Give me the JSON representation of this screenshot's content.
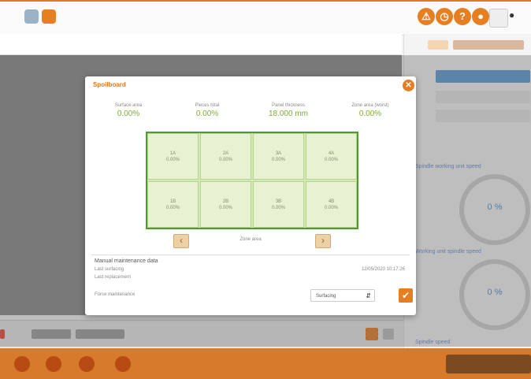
{
  "modal": {
    "title": "Spoilboard",
    "stats": [
      {
        "label": "Surface area",
        "value": "0.00%"
      },
      {
        "label": "Pieces total",
        "value": "0.00%"
      },
      {
        "label": "Panel thickness",
        "value": "18.000 mm"
      },
      {
        "label": "Zone area (worst)",
        "value": "0.00%"
      }
    ],
    "cells": [
      {
        "id": "1A",
        "value": "0.00%"
      },
      {
        "id": "2A",
        "value": "0.00%"
      },
      {
        "id": "3A",
        "value": "0.00%"
      },
      {
        "id": "4A",
        "value": "0.00%"
      },
      {
        "id": "1B",
        "value": "0.00%"
      },
      {
        "id": "2B",
        "value": "0.00%"
      },
      {
        "id": "3B",
        "value": "0.00%"
      },
      {
        "id": "4B",
        "value": "0.00%"
      }
    ],
    "nav_label": "Zone area",
    "maintenance": {
      "title": "Manual maintenance data",
      "last_surfacing_label": "Last surfacing",
      "last_surfacing_value": "12/05/2020 10:17:26",
      "last_replacement_label": "Last replacement",
      "force_label": "Force maintenance",
      "select_value": "Surfacing"
    }
  },
  "rightpanel": {
    "label1": "Spindle working unit speed",
    "label2": "Working unit spindle speed",
    "gauge1_value": "0 %",
    "gauge2_value": "0 %",
    "bottom_label": "Spindle speed"
  },
  "colors": {
    "accent": "#e67e22",
    "grid_border": "#4f9a2e",
    "stat_value": "#7fae2d"
  },
  "icons": [
    "warning-icon",
    "clock-icon",
    "help-icon",
    "chat-icon",
    "close-icon",
    "chevron-left-icon",
    "chevron-right-icon",
    "check-icon"
  ]
}
